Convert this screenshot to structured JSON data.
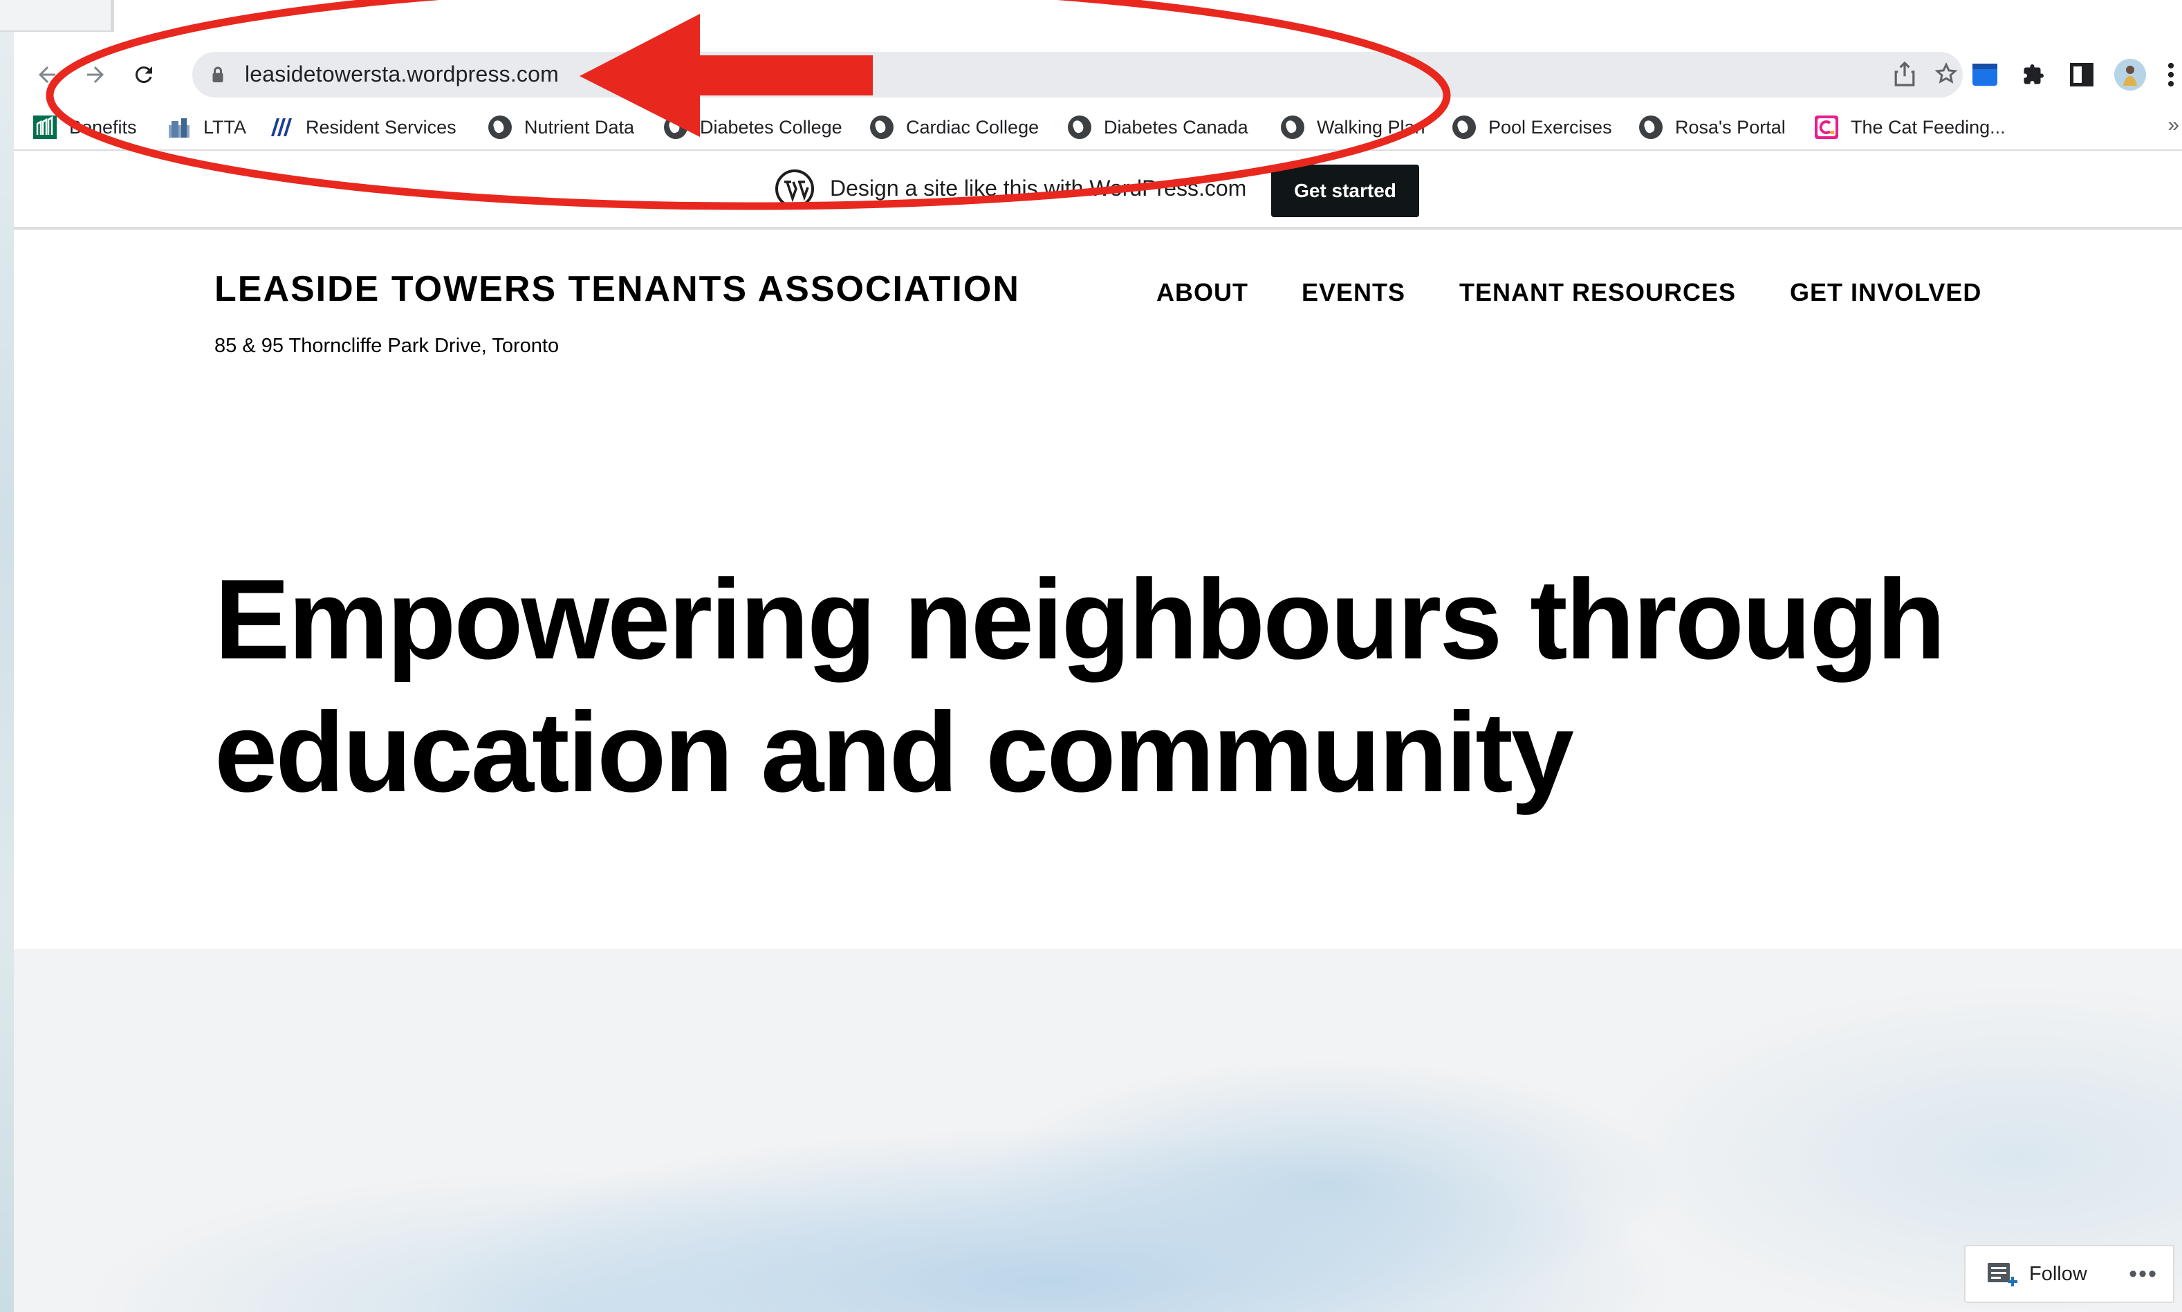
{
  "browser": {
    "url": "leasidetowersta.wordpress.com"
  },
  "bookmarks": [
    {
      "label": "Benefits",
      "icon": "manulife-icon"
    },
    {
      "label": "LTTA",
      "icon": "building-icon"
    },
    {
      "label": "Resident Services",
      "icon": "resident-services-logo-icon"
    },
    {
      "label": "Nutrient Data",
      "icon": "globe-icon"
    },
    {
      "label": "Diabetes College",
      "icon": "globe-icon"
    },
    {
      "label": "Cardiac College",
      "icon": "globe-icon"
    },
    {
      "label": "Diabetes Canada",
      "icon": "globe-icon"
    },
    {
      "label": "Walking Plan",
      "icon": "globe-icon"
    },
    {
      "label": "Pool Exercises",
      "icon": "globe-icon"
    },
    {
      "label": "Rosa's Portal",
      "icon": "globe-icon"
    },
    {
      "label": "The Cat Feeding...",
      "icon": "cat-feeding-icon"
    }
  ],
  "bookmarks_more": "»",
  "wp_banner": {
    "text": "Design a site like this with WordPress.com",
    "button": "Get started"
  },
  "site": {
    "title": "LEASIDE TOWERS TENANTS ASSOCIATION",
    "tagline": "85 & 95 Thorncliffe Park Drive, Toronto",
    "nav": [
      "ABOUT",
      "EVENTS",
      "TENANT RESOURCES",
      "GET INVOLVED"
    ]
  },
  "hero": {
    "line1": "Empowering neighbours through",
    "line2": "education and community"
  },
  "follow": {
    "label": "Follow",
    "more": "•••"
  },
  "colors": {
    "annotation_red": "#e8281f",
    "button_dark": "#101517"
  }
}
